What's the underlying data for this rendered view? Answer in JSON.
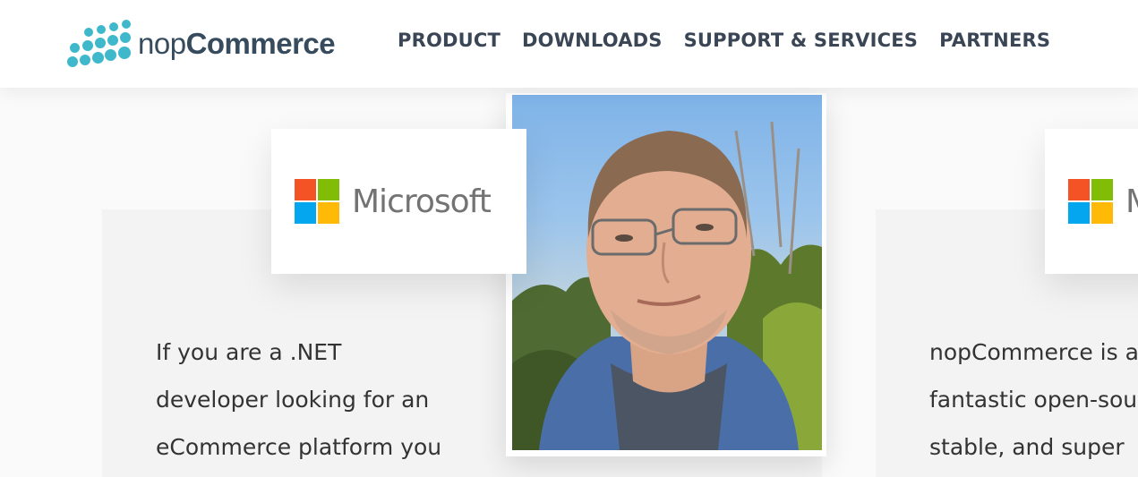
{
  "header": {
    "logo": {
      "prefix": "nop",
      "suffix": "Commerce",
      "icon": "dots-logo-icon"
    },
    "nav": [
      {
        "label": "PRODUCT"
      },
      {
        "label": "DOWNLOADS"
      },
      {
        "label": "SUPPORT & SERVICES"
      },
      {
        "label": "PARTNERS"
      }
    ]
  },
  "testimonials": [
    {
      "company": "Microsoft",
      "photo": "person-photo",
      "lines": [
        "If you are a .NET",
        "developer looking for an",
        "eCommerce platform you"
      ]
    },
    {
      "company": "M",
      "lines": [
        "nopCommerce is a",
        "fantastic open-sou",
        "stable, and super"
      ]
    }
  ],
  "colors": {
    "brand": "#3fb8cc",
    "nav_text": "#3a4655",
    "ms_red": "#f35325",
    "ms_green": "#81bc06",
    "ms_blue": "#05a6f0",
    "ms_yellow": "#ffba08"
  }
}
